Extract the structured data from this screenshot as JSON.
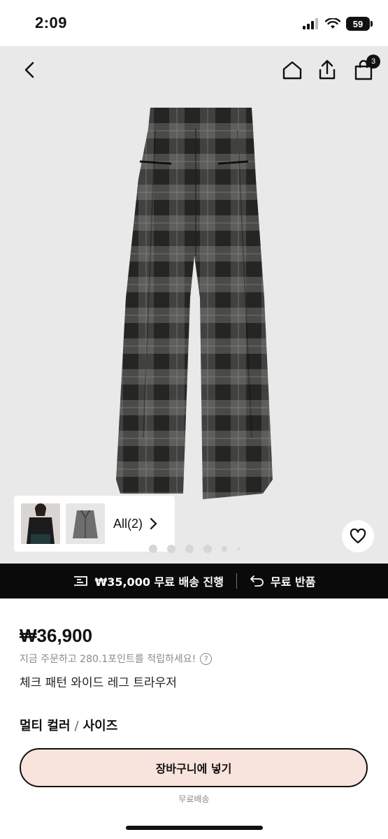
{
  "status": {
    "time": "2:09",
    "battery": "59"
  },
  "nav": {
    "cart_count": "3"
  },
  "gallery": {
    "thumb_label": "All(2)",
    "page_index": 3,
    "page_count": 6
  },
  "promo": {
    "shipping_text": "₩35,000 무료 배송 진행",
    "return_text": "무료 반품"
  },
  "product": {
    "price": "₩36,900",
    "points_text": "지금 주문하고 280.1포인트를 적립하세요!",
    "points_help": "?",
    "name": "체크 패턴 와이드 레그 트라우저",
    "option_color": "멀티 컬러",
    "option_sep": "/",
    "option_size": "사이즈"
  },
  "actions": {
    "add_to_cart": "장바구니에 넣기",
    "shipping_note": "무료배송"
  },
  "colors": {
    "hero_bg": "#e9e9e9",
    "promo_bg": "#0a0a0a",
    "cart_button_bg": "#f8e4dc"
  }
}
